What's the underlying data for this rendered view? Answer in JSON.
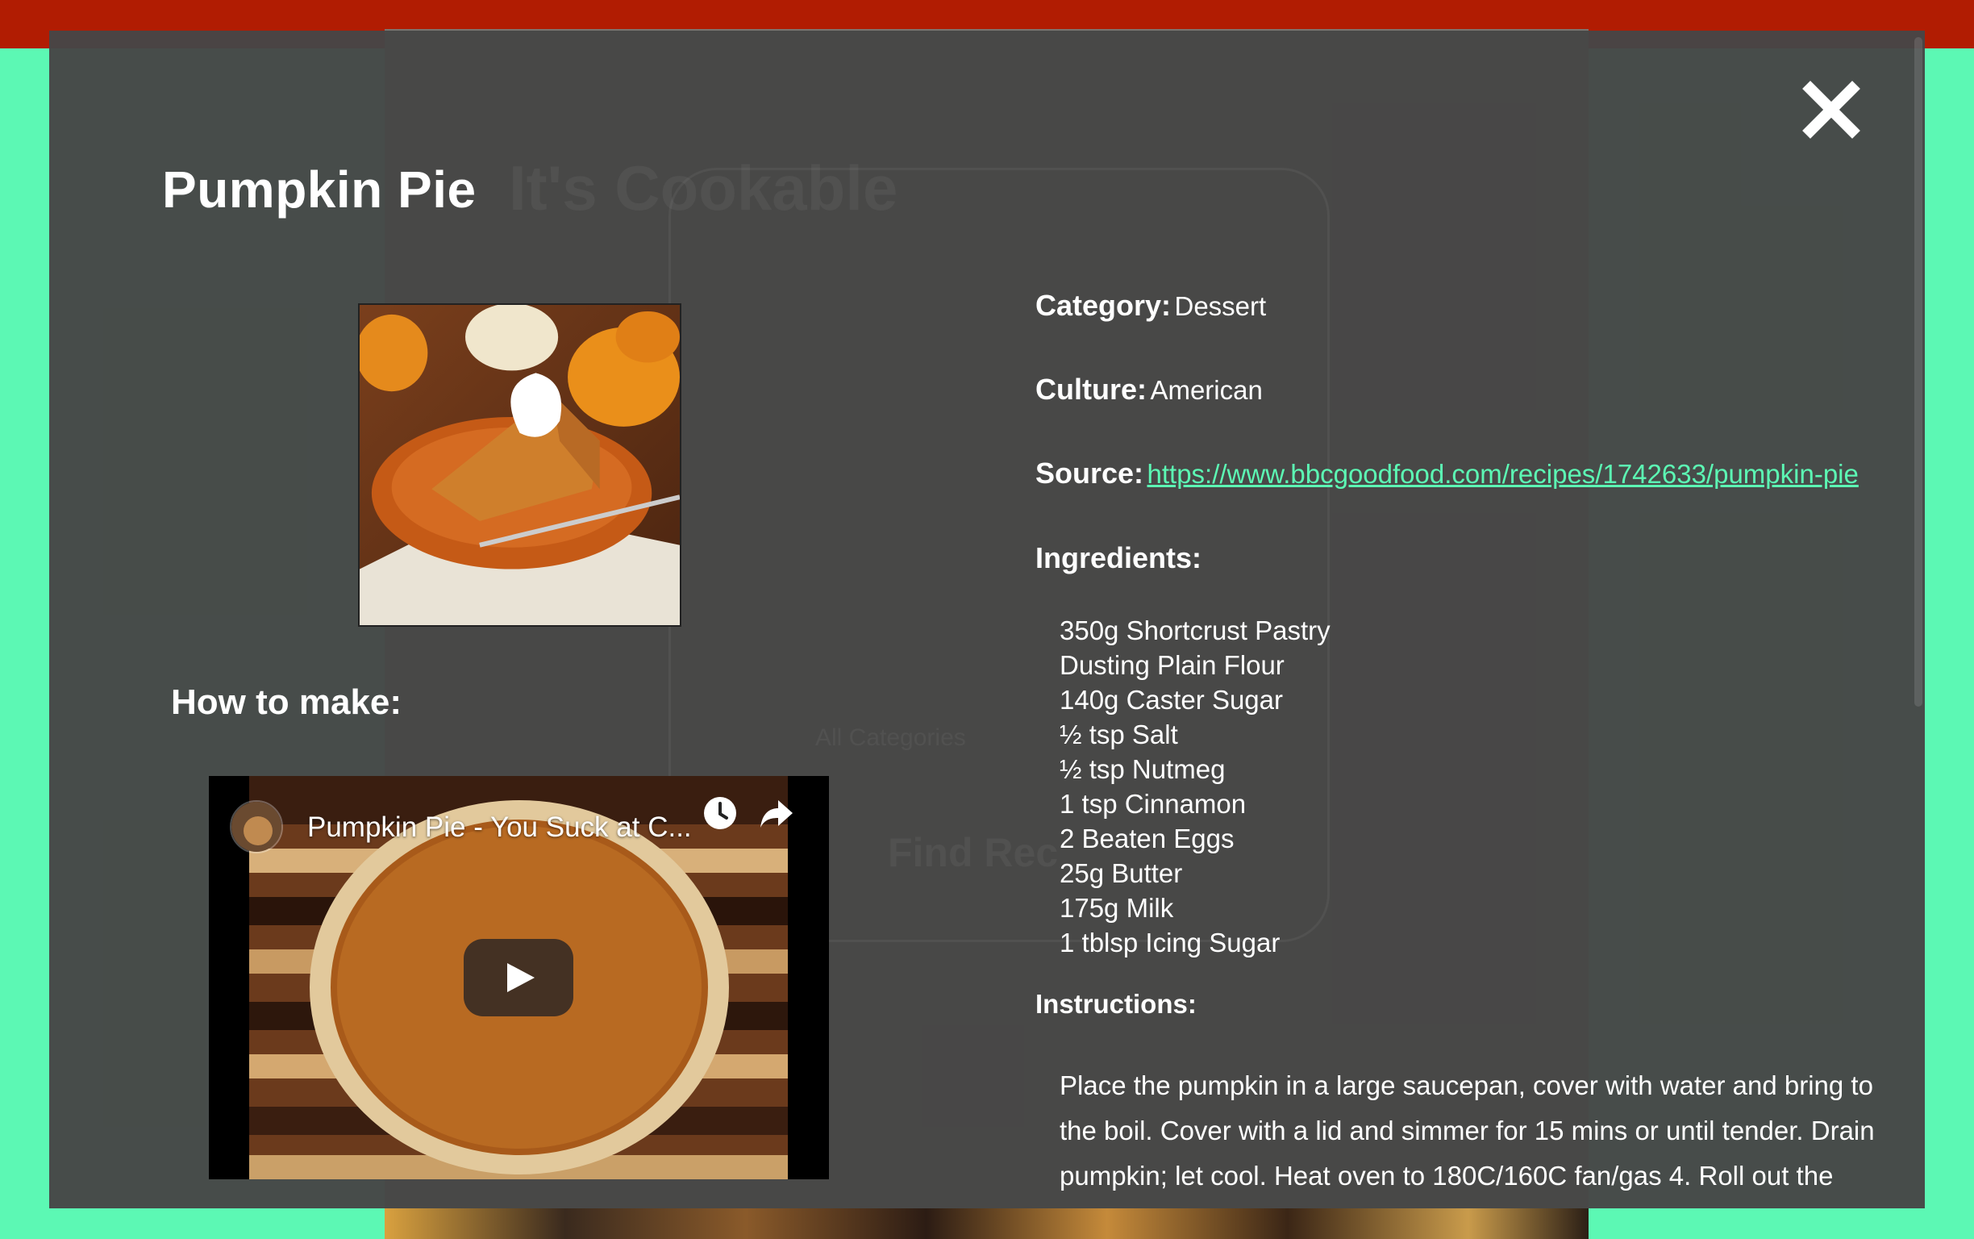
{
  "recipe": {
    "title": "Pumpkin Pie",
    "category_label": "Category:",
    "category": "Dessert",
    "culture_label": "Culture:",
    "culture": "American",
    "source_label": "Source:",
    "source_url": "https://www.bbcgoodfood.com/recipes/1742633/pumpkin-pie",
    "ingredients_label": "Ingredients:",
    "ingredients": [
      "350g Shortcrust Pastry",
      "Dusting Plain Flour",
      "140g Caster Sugar",
      "½ tsp Salt",
      "½ tsp Nutmeg",
      "1 tsp Cinnamon",
      "2 Beaten Eggs",
      "25g Butter",
      "175g Milk",
      "1 tblsp Icing Sugar"
    ],
    "instructions_label": "Instructions:",
    "instructions": "Place the pumpkin in a large saucepan, cover with water and bring to the boil. Cover with a lid and simmer for 15 mins or until tender. Drain pumpkin; let cool. Heat oven to 180C/160C fan/gas 4. Roll out the"
  },
  "how_to": {
    "heading": "How to make:",
    "video_title": "Pumpkin Pie - You Suck at C..."
  },
  "icons": {
    "close": "close-icon",
    "play": "play-icon",
    "watch_later": "clock-icon",
    "share": "share-icon"
  },
  "background": {
    "site_title": "It's Cookable",
    "faint_text_1": "All Categories",
    "faint_text_2": "Find Rec"
  },
  "colors": {
    "accent": "#5cf8b4",
    "top_strip": "#b11c02",
    "modal_bg": "#464646",
    "video_play": "#3a2c24"
  }
}
